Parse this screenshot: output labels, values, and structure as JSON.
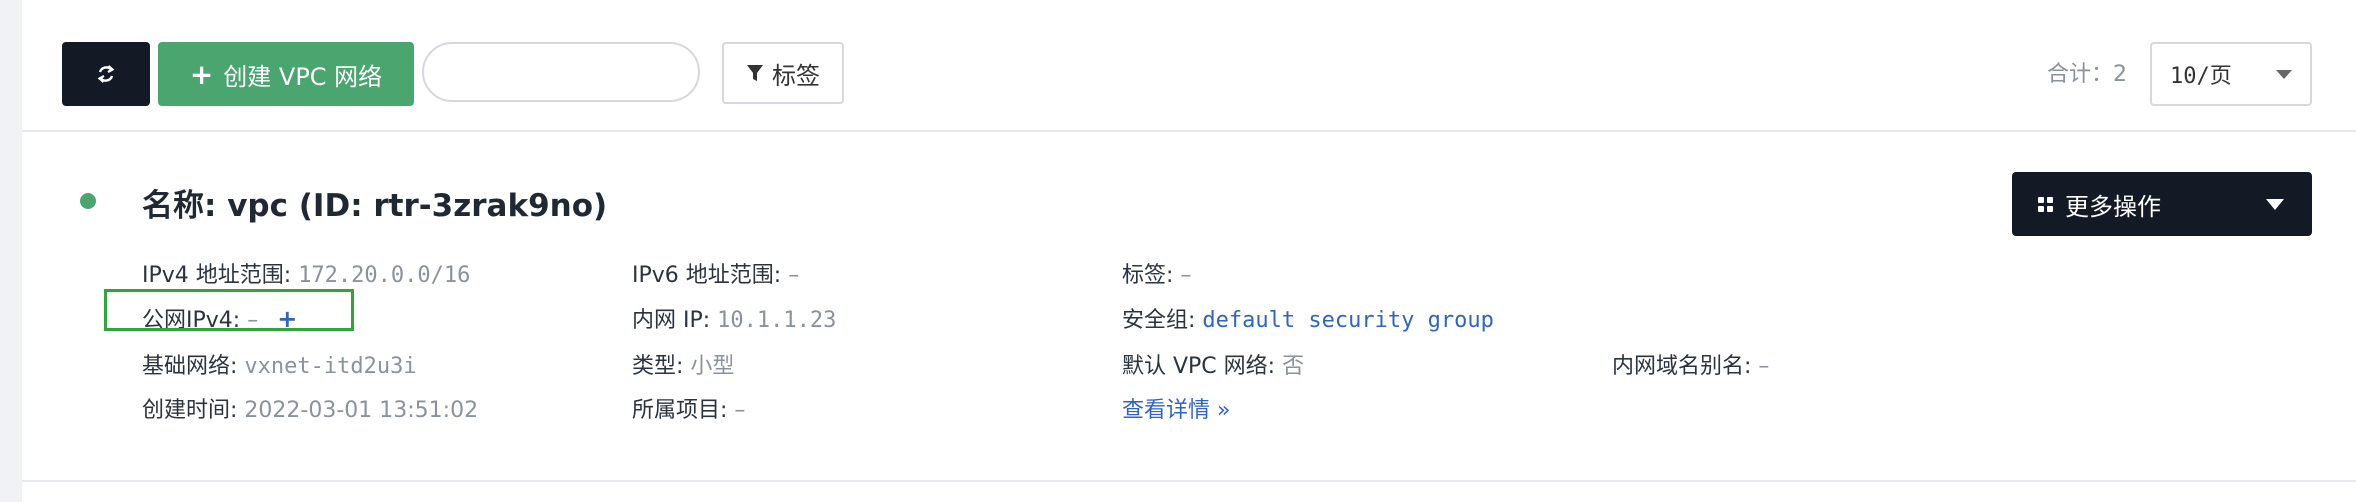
{
  "toolbar": {
    "refresh_icon": "refresh-icon",
    "create_label": "创建 VPC 网络",
    "create_plus": "+",
    "search_placeholder": "",
    "tag_label": "标签",
    "total_text": "合计：2",
    "page_size": "10/页"
  },
  "vpc": {
    "title": "名称: vpc (ID: rtr-3zrak9no)",
    "status_color": "#4aa56f",
    "more_actions": "更多操作",
    "fields": {
      "ipv4_label": "IPv4 地址范围:",
      "ipv4_value": "172.20.0.0/16",
      "public_ipv4_label": "公网IPv4:",
      "public_ipv4_value": "–",
      "public_ipv4_add": "+",
      "base_net_label": "基础网络:",
      "base_net_value": "vxnet-itd2u3i",
      "created_label": "创建时间:",
      "created_value": "2022-03-01 13:51:02",
      "ipv6_label": "IPv6 地址范围:",
      "ipv6_value": "–",
      "inner_ip_label": "内网 IP:",
      "inner_ip_value": "10.1.1.23",
      "type_label": "类型:",
      "type_value": "小型",
      "project_label": "所属项目:",
      "project_value": "–",
      "tags_label": "标签:",
      "tags_value": "–",
      "sg_label": "安全组:",
      "sg_value": "default security group",
      "default_vpc_label": "默认 VPC 网络:",
      "default_vpc_value": "否",
      "details_link": "查看详情 »",
      "alias_label": "内网域名别名:",
      "alias_value": "–"
    }
  },
  "colors": {
    "accent_green": "#4aa56f",
    "dark": "#131a25",
    "link": "#2e64c4",
    "highlight": "#2fa53a"
  }
}
